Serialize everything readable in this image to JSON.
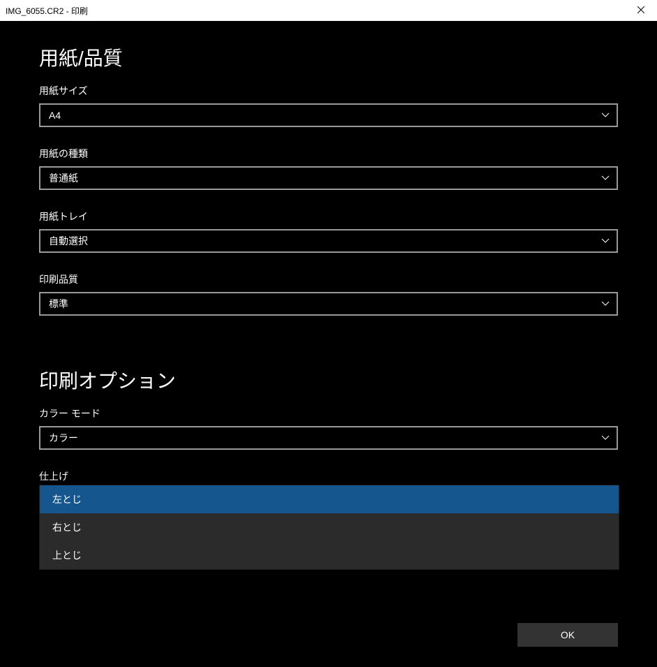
{
  "window": {
    "title": "IMG_6055.CR2 - 印刷"
  },
  "sections": {
    "paper_quality": {
      "heading": "用紙/品質",
      "paper_size": {
        "label": "用紙サイズ",
        "value": "A4"
      },
      "paper_type": {
        "label": "用紙の種類",
        "value": "普通紙"
      },
      "paper_tray": {
        "label": "用紙トレイ",
        "value": "自動選択"
      },
      "print_quality": {
        "label": "印刷品質",
        "value": "標準"
      }
    },
    "print_options": {
      "heading": "印刷オプション",
      "color_mode": {
        "label": "カラー モード",
        "value": "カラー"
      },
      "finishing": {
        "label": "仕上げ",
        "options": [
          "左とじ",
          "右とじ",
          "上とじ"
        ],
        "selected_index": 0
      }
    }
  },
  "buttons": {
    "ok": "OK"
  }
}
